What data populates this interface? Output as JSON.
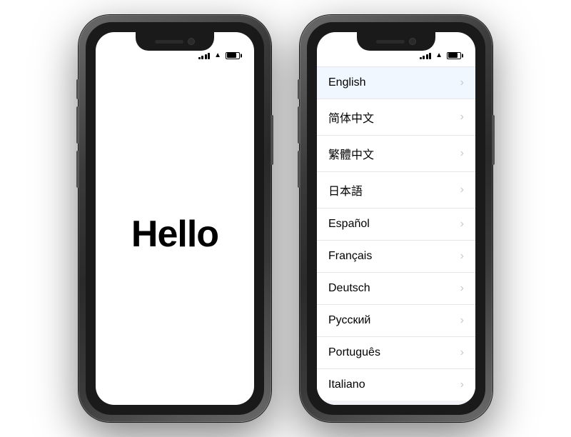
{
  "phones": [
    {
      "id": "hello-phone",
      "type": "hello",
      "content": {
        "hello_text": "Hello"
      }
    },
    {
      "id": "language-phone",
      "type": "language-list",
      "languages": [
        {
          "name": "English",
          "selected": true
        },
        {
          "name": "简体中文",
          "selected": false
        },
        {
          "name": "繁體中文",
          "selected": false
        },
        {
          "name": "日本語",
          "selected": false
        },
        {
          "name": "Español",
          "selected": false
        },
        {
          "name": "Français",
          "selected": false
        },
        {
          "name": "Deutsch",
          "selected": false
        },
        {
          "name": "Русский",
          "selected": false
        },
        {
          "name": "Português",
          "selected": false
        },
        {
          "name": "Italiano",
          "selected": false
        }
      ]
    }
  ],
  "chevron": "›"
}
